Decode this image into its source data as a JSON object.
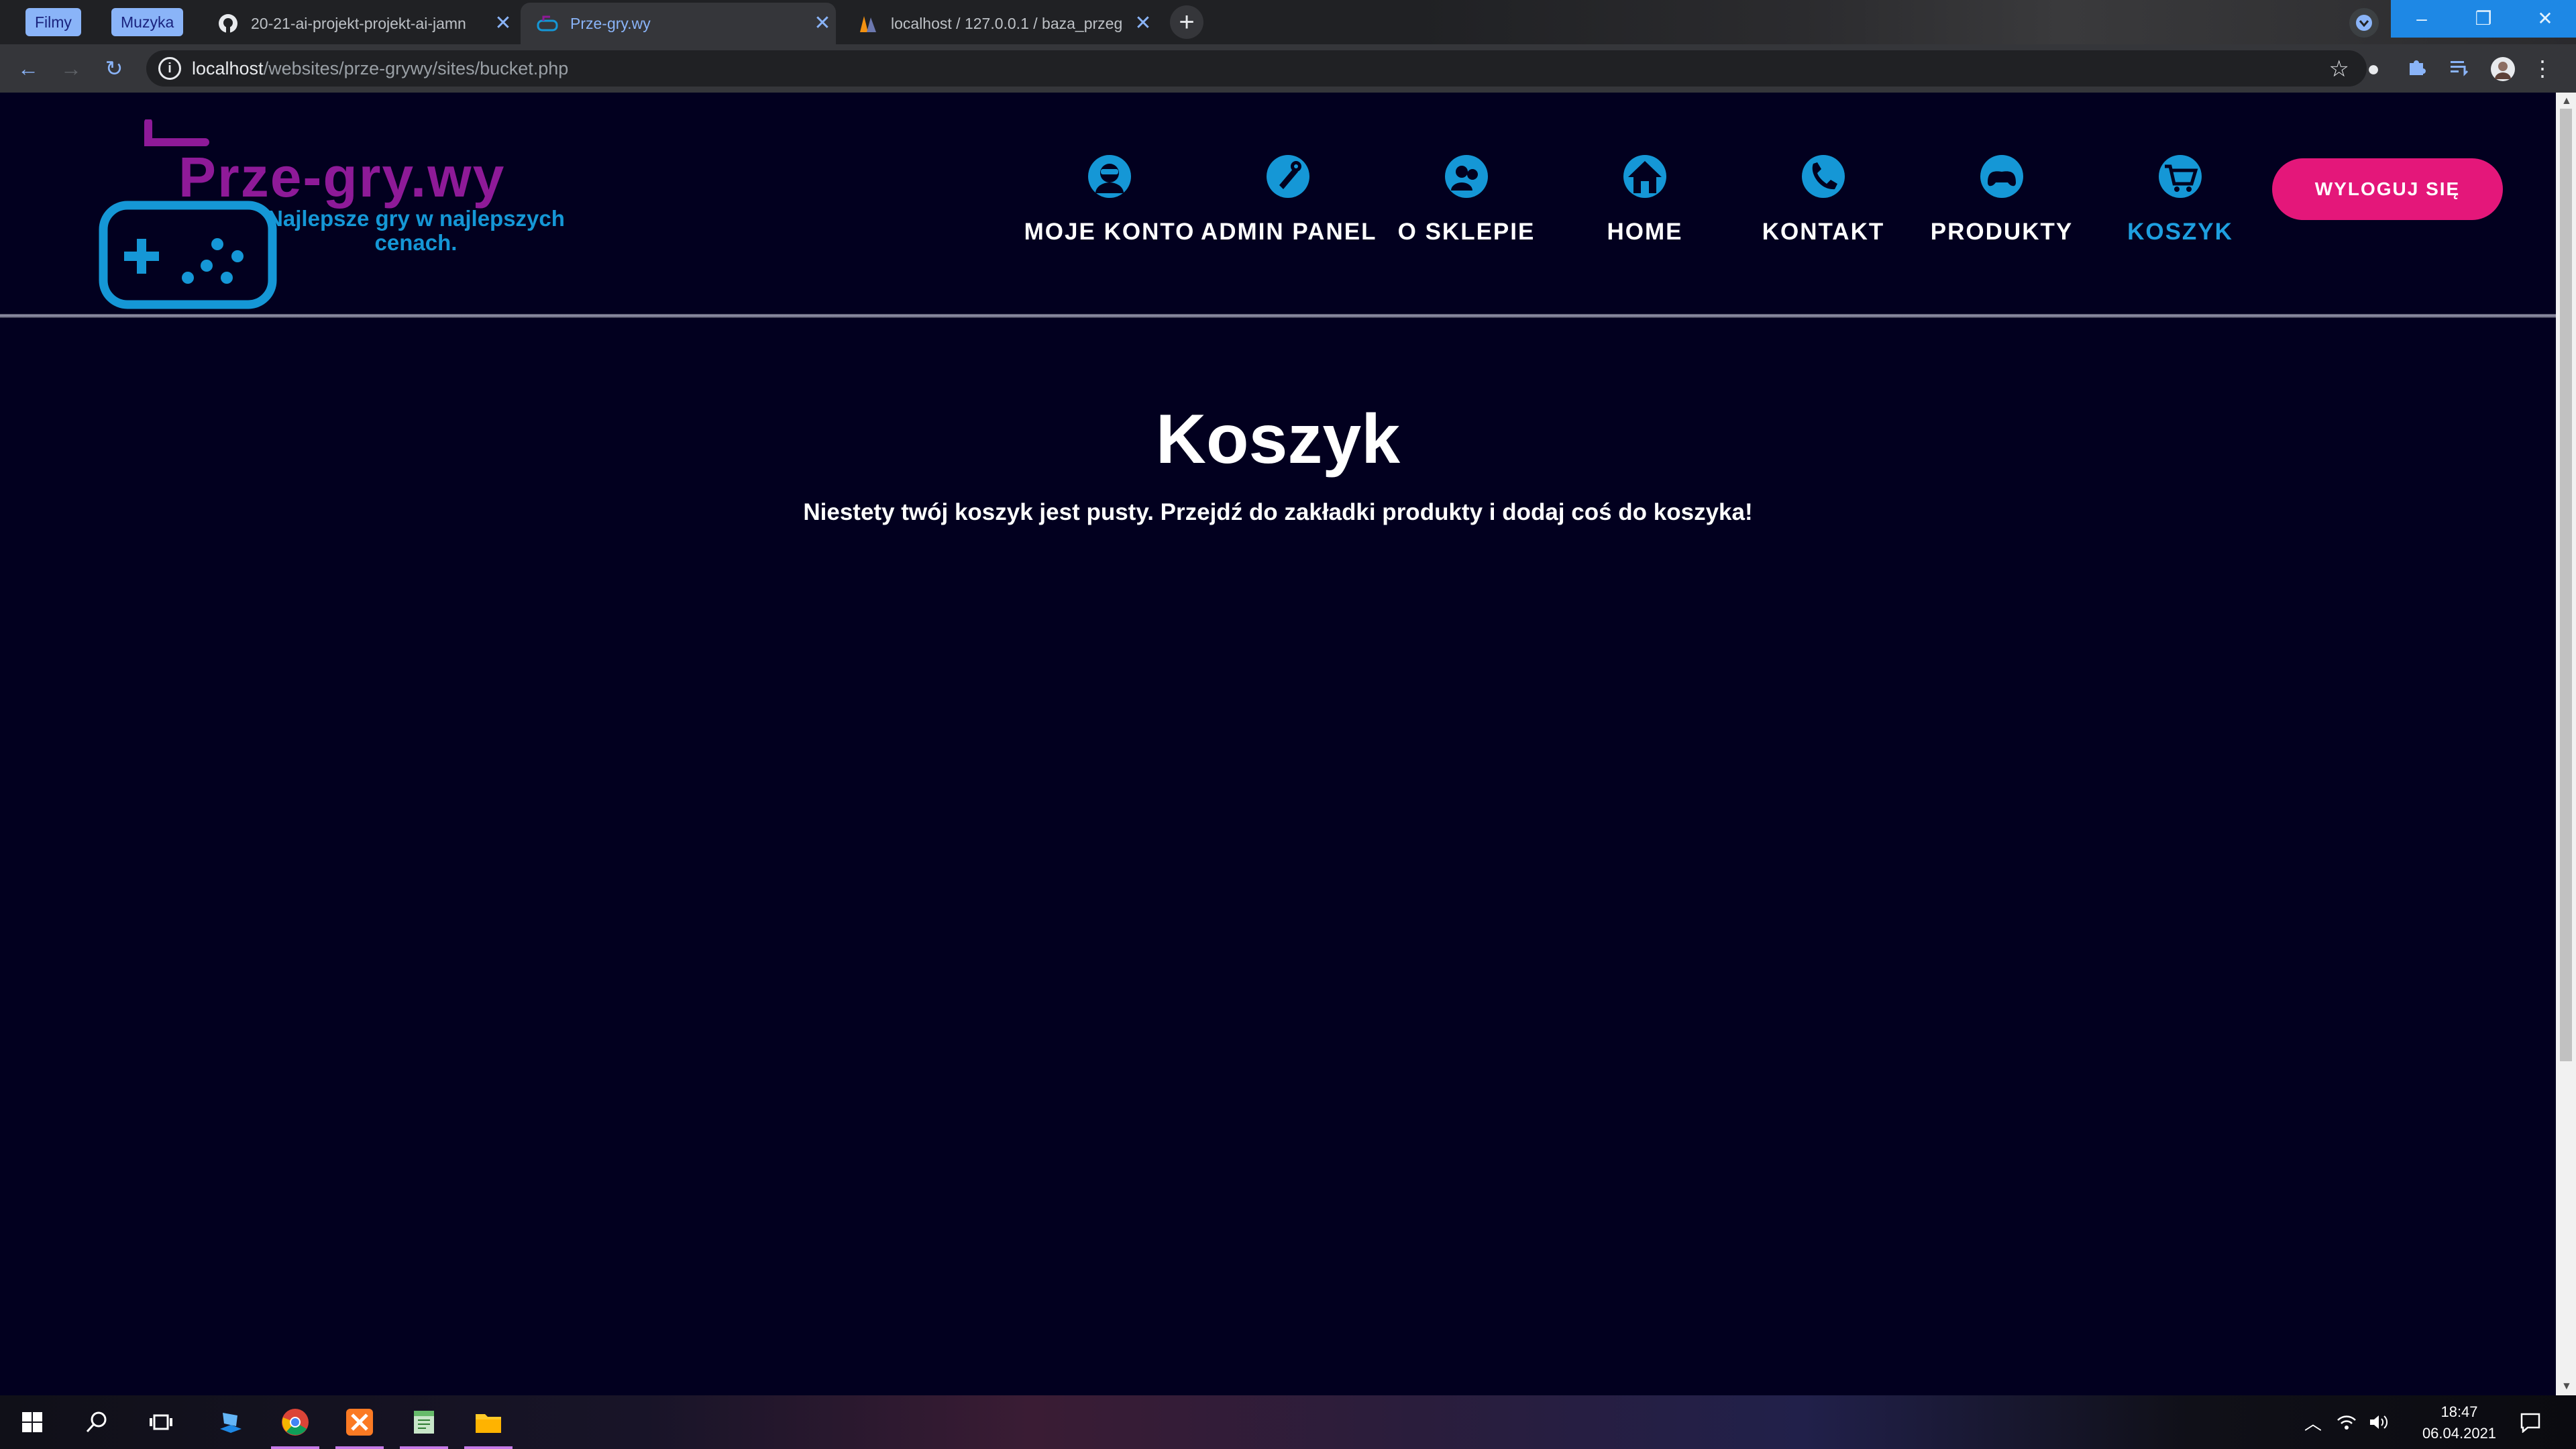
{
  "browser": {
    "bookmarks": [
      "Filmy",
      "Muzyka"
    ],
    "tabs": [
      {
        "title": "20-21-ai-projekt-projekt-ai-jamn",
        "icon": "github-icon",
        "active": false
      },
      {
        "title": "Prze-gry.wy",
        "icon": "gamepad-icon",
        "active": true
      },
      {
        "title": "localhost / 127.0.0.1 / baza_przeg",
        "icon": "phpmyadmin-icon",
        "active": false
      }
    ],
    "url_host": "localhost",
    "url_path": "/websites/prze-grywy/sites/bucket.php"
  },
  "site": {
    "logo_title": "Prze-gry.wy",
    "logo_sub_line1": "Najlepsze gry w najlepszych",
    "logo_sub_line2": "cenach.",
    "nav": [
      {
        "label": "MOJE KONTO",
        "icon": "account-icon",
        "active": false
      },
      {
        "label": "ADMIN PANEL",
        "icon": "admin-icon",
        "active": false
      },
      {
        "label": "O SKLEPIE",
        "icon": "about-icon",
        "active": false
      },
      {
        "label": "HOME",
        "icon": "home-icon",
        "active": false
      },
      {
        "label": "KONTAKT",
        "icon": "phone-icon",
        "active": false
      },
      {
        "label": "PRODUKTY",
        "icon": "controller-icon",
        "active": false
      },
      {
        "label": "KOSZYK",
        "icon": "cart-icon",
        "active": true
      }
    ],
    "logout_label": "WYLOGUJ SIĘ",
    "page_title": "Koszyk",
    "empty_message": "Niestety twój koszyk jest pusty. Przejdź do zakładki produkty i dodaj coś do koszyka!"
  },
  "taskbar": {
    "time": "18:47",
    "date": "06.04.2021"
  },
  "colors": {
    "background": "#02001f",
    "accent_blue": "#1e9fe0",
    "logo_purple": "#8e1a98",
    "logout_pink": "#e4177a"
  }
}
